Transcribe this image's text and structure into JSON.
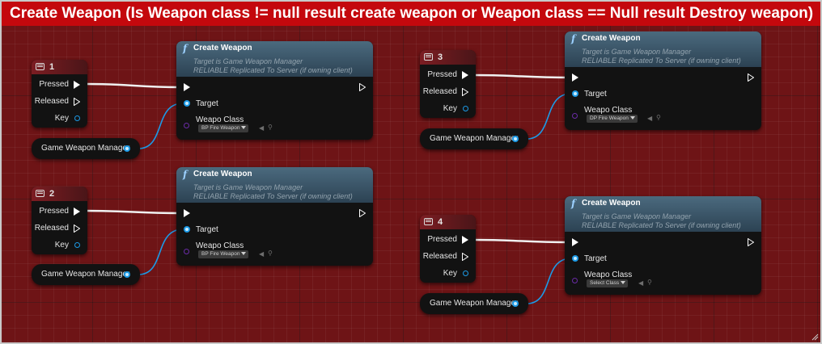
{
  "comment": {
    "title": "Create Weapon (Is Weapon class != null result create weapon  or Weapon class == Null result Destroy weapon)"
  },
  "key_nodes": [
    {
      "key": "1",
      "pressed": "Pressed",
      "released": "Released",
      "key_label": "Key"
    },
    {
      "key": "2",
      "pressed": "Pressed",
      "released": "Released",
      "key_label": "Key"
    },
    {
      "key": "3",
      "pressed": "Pressed",
      "released": "Released",
      "key_label": "Key"
    },
    {
      "key": "4",
      "pressed": "Pressed",
      "released": "Released",
      "key_label": "Key"
    }
  ],
  "variable_nodes": [
    {
      "label": "Game Weapon Manager"
    },
    {
      "label": "Game Weapon Manager"
    },
    {
      "label": "Game Weapon Manager"
    },
    {
      "label": "Game Weapon Manager"
    }
  ],
  "function_nodes": [
    {
      "title": "Create Weapon",
      "target_line": "Target is Game Weapon Manager",
      "replication_line": "RELIABLE Replicated To Server (if owning client)",
      "target_label": "Target",
      "class_label": "Weapo Class",
      "class_value": "BP Fire Weapon"
    },
    {
      "title": "Create Weapon",
      "target_line": "Target is Game Weapon Manager",
      "replication_line": "RELIABLE Replicated To Server (if owning client)",
      "target_label": "Target",
      "class_label": "Weapo Class",
      "class_value": "BP Fire Weapon"
    },
    {
      "title": "Create Weapon",
      "target_line": "Target is Game Weapon Manager",
      "replication_line": "RELIABLE Replicated To Server (if owning client)",
      "target_label": "Target",
      "class_label": "Weapo Class",
      "class_value": "DP Fire Weapon"
    },
    {
      "title": "Create Weapon",
      "target_line": "Target is Game Weapon Manager",
      "replication_line": "RELIABLE Replicated To Server (if owning client)",
      "target_label": "Target",
      "class_label": "Weapo Class",
      "class_value": "Select Class"
    }
  ],
  "colors": {
    "graph_background": "#6e1416",
    "comment_bar": "#c4080d",
    "object_pin": "#1c9ae6",
    "class_pin": "#6a2ba6",
    "function_header": "#3b5668",
    "key_header": "#7c1d22"
  },
  "icons": {
    "key_node": "keyboard-icon",
    "function_node": "function-f-icon",
    "asset_browse": "arrow-left-icon",
    "asset_find": "search-icon"
  }
}
